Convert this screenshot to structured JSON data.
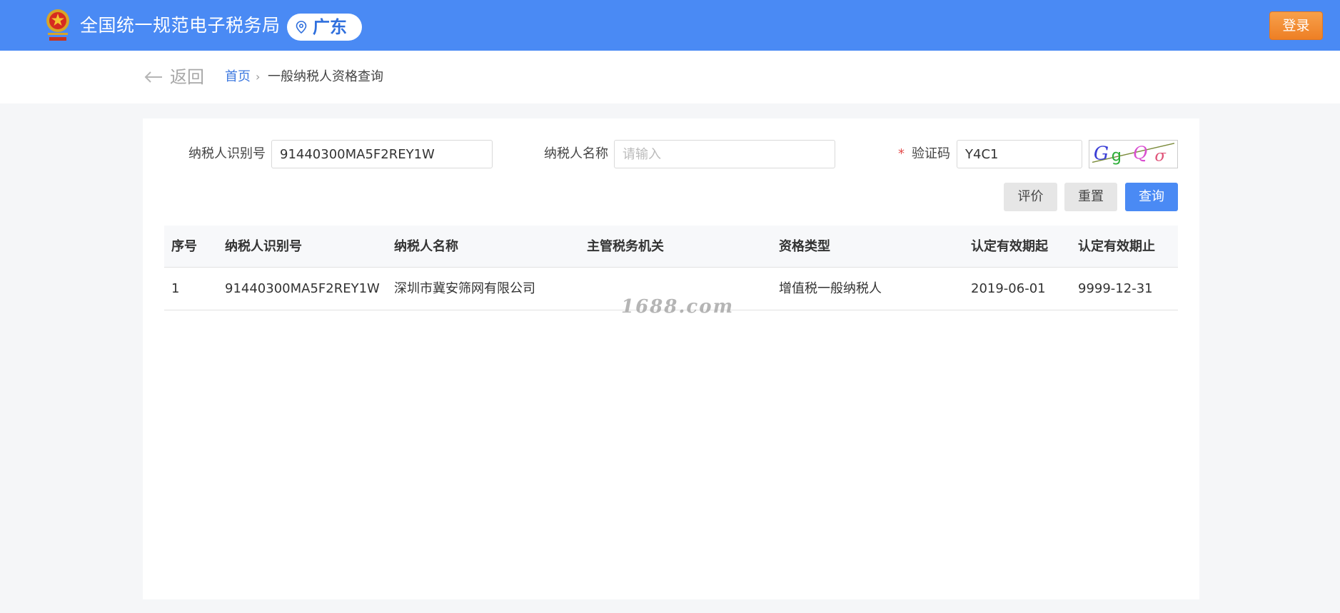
{
  "header": {
    "site_title": "全国统一规范电子税务局",
    "region": "广东",
    "login_label": "登录"
  },
  "breadcrumb": {
    "back_label": "返回",
    "home_label": "首页",
    "separator": "›",
    "current_label": "一般纳税人资格查询"
  },
  "form": {
    "taxpayer_id_label": "纳税人识别号",
    "taxpayer_id_value": "91440300MA5F2REY1W",
    "taxpayer_name_label": "纳税人名称",
    "taxpayer_name_placeholder": "请输入",
    "required_mark": "*",
    "captcha_label": "验证码",
    "captcha_value": "Y4C1",
    "captcha_image_text": "GgQσ"
  },
  "actions": {
    "evaluate_label": "评价",
    "reset_label": "重置",
    "query_label": "查询"
  },
  "table": {
    "columns": [
      "序号",
      "纳税人识别号",
      "纳税人名称",
      "主管税务机关",
      "资格类型",
      "认定有效期起",
      "认定有效期止"
    ],
    "rows": [
      [
        "1",
        "91440300MA5F2REY1W",
        "深圳市冀安筛网有限公司",
        "",
        "增值税一般纳税人",
        "2019-06-01",
        "9999-12-31"
      ]
    ]
  },
  "watermark": "1688.com",
  "colors": {
    "header_bg": "#4a8af4",
    "login_orange": "#ee7f25",
    "link_blue": "#3f7ae0",
    "required_red": "#e34b4b"
  }
}
